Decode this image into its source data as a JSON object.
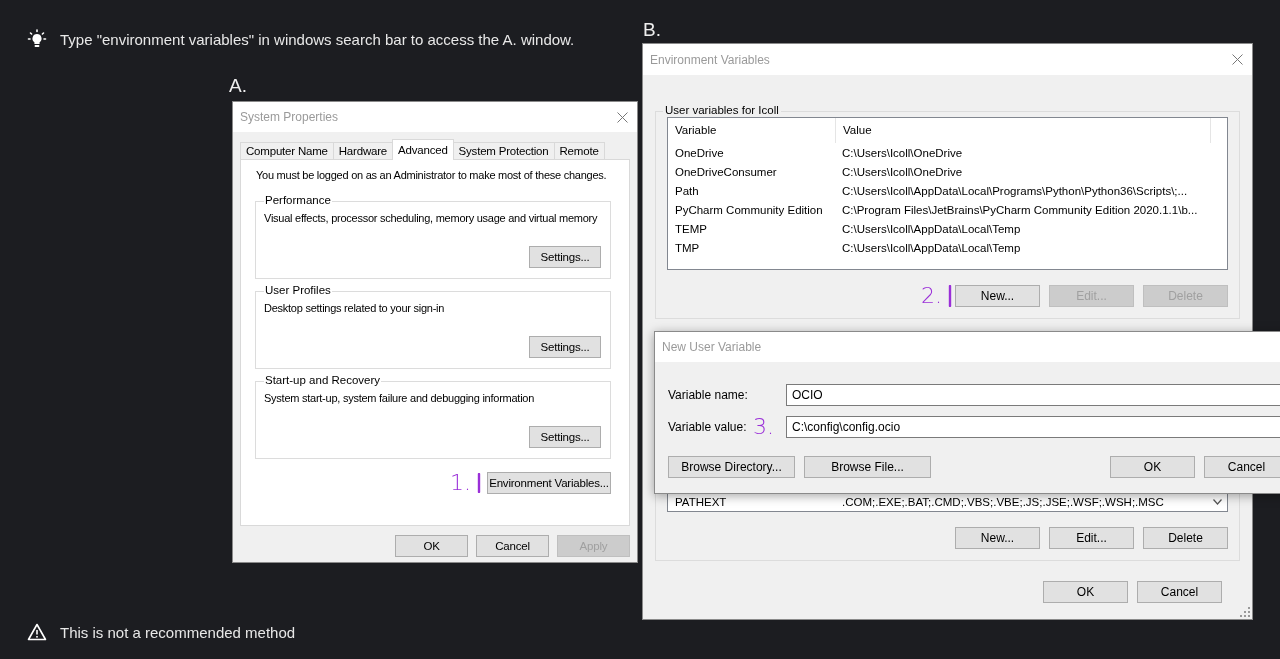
{
  "tip": {
    "text": "Type \"environment variables\" in windows search bar to access the A. window."
  },
  "system_properties": {
    "marker": "A.",
    "title": "System Properties",
    "tabs": [
      {
        "label": "Computer Name",
        "selected": false
      },
      {
        "label": "Hardware",
        "selected": false
      },
      {
        "label": "Advanced",
        "selected": true
      },
      {
        "label": "System Protection",
        "selected": false
      },
      {
        "label": "Remote",
        "selected": false
      }
    ],
    "note": "You must be logged on as an Administrator to make most of these changes.",
    "groups": [
      {
        "title": "Performance",
        "description": "Visual effects, processor scheduling, memory usage and virtual memory",
        "button": "Settings..."
      },
      {
        "title": "User Profiles",
        "description": "Desktop settings related to your sign-in",
        "button": "Settings..."
      },
      {
        "title": "Start-up and Recovery",
        "description": "System start-up, system failure and debugging information",
        "button": "Settings..."
      }
    ],
    "annotation": "1.",
    "env_button": "Environment Variables...",
    "buttons": [
      {
        "label": "OK",
        "disabled": false
      },
      {
        "label": "Cancel",
        "disabled": false
      },
      {
        "label": "Apply",
        "disabled": true
      }
    ]
  },
  "environment_variables": {
    "marker": "B.",
    "title": "Environment Variables",
    "user_group": {
      "title": "User variables for Icoll",
      "columns": [
        "Variable",
        "Value"
      ],
      "rows": [
        {
          "variable": "OneDrive",
          "value": "C:\\Users\\Icoll\\OneDrive"
        },
        {
          "variable": "OneDriveConsumer",
          "value": "C:\\Users\\Icoll\\OneDrive"
        },
        {
          "variable": "Path",
          "value": "C:\\Users\\Icoll\\AppData\\Local\\Programs\\Python\\Python36\\Scripts\\;..."
        },
        {
          "variable": "PyCharm Community Edition",
          "value": "C:\\Program Files\\JetBrains\\PyCharm Community Edition 2020.1.1\\b..."
        },
        {
          "variable": "TEMP",
          "value": "C:\\Users\\Icoll\\AppData\\Local\\Temp"
        },
        {
          "variable": "TMP",
          "value": "C:\\Users\\Icoll\\AppData\\Local\\Temp"
        }
      ],
      "annotation": "2.",
      "buttons": [
        {
          "label": "New...",
          "disabled": false
        },
        {
          "label": "Edit...",
          "disabled": true
        },
        {
          "label": "Delete",
          "disabled": true
        }
      ]
    },
    "system_group": {
      "rows": [
        {
          "variable": "PATHEXT",
          "value": ".COM;.EXE;.BAT;.CMD;.VBS;.VBE;.JS;.JSE;.WSF;.WSH;.MSC"
        }
      ],
      "buttons": [
        {
          "label": "New...",
          "disabled": false
        },
        {
          "label": "Edit...",
          "disabled": false
        },
        {
          "label": "Delete",
          "disabled": false
        }
      ]
    },
    "buttons": [
      {
        "label": "OK",
        "disabled": false
      },
      {
        "label": "Cancel",
        "disabled": false
      }
    ]
  },
  "new_user_variable": {
    "title": "New User Variable",
    "fields": [
      {
        "label": "Variable name:",
        "value": "OCIO"
      },
      {
        "label": "Variable value:",
        "value": "C:\\config\\config.ocio",
        "annotation": "3."
      }
    ],
    "browse_buttons": [
      "Browse Directory...",
      "Browse File..."
    ],
    "buttons": [
      "OK",
      "Cancel"
    ]
  },
  "warning": {
    "text": "This is not a recommended method"
  }
}
